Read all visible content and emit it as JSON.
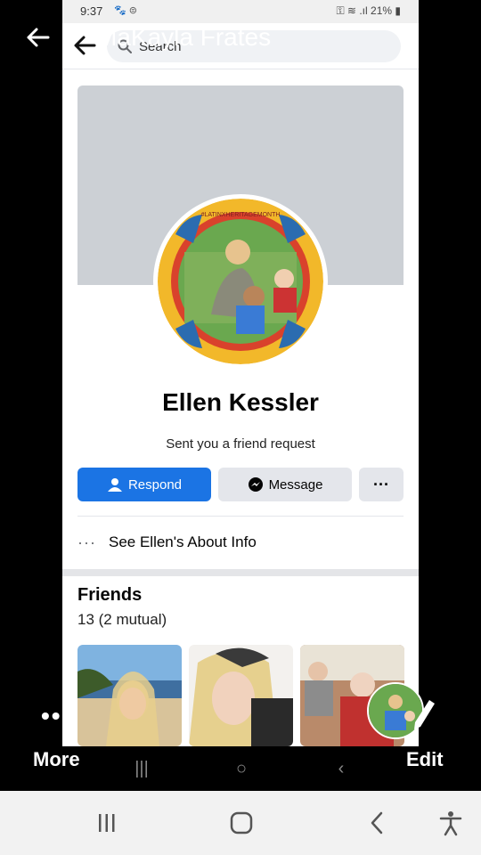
{
  "viewer": {
    "title": "MaKayla Frates",
    "more_label": "More",
    "edit_label": "Edit"
  },
  "statusbar": {
    "time": "9:37",
    "battery": "21%"
  },
  "fb": {
    "search_placeholder": "Search"
  },
  "profile": {
    "name": "Ellen Kessler",
    "subtitle": "Sent you a friend request",
    "avatar_banner": "#LATINXHERITAGEMONTH"
  },
  "actions": {
    "respond_label": "Respond",
    "message_label": "Message",
    "more_label": "···"
  },
  "about": {
    "dots": "···",
    "label": "See Ellen's About Info"
  },
  "friends": {
    "title": "Friends",
    "count": "13 (2 mutual)"
  },
  "colors": {
    "primary": "#1b74e4",
    "secondary_button": "#e4e6eb",
    "cover": "#ccd0d5"
  }
}
